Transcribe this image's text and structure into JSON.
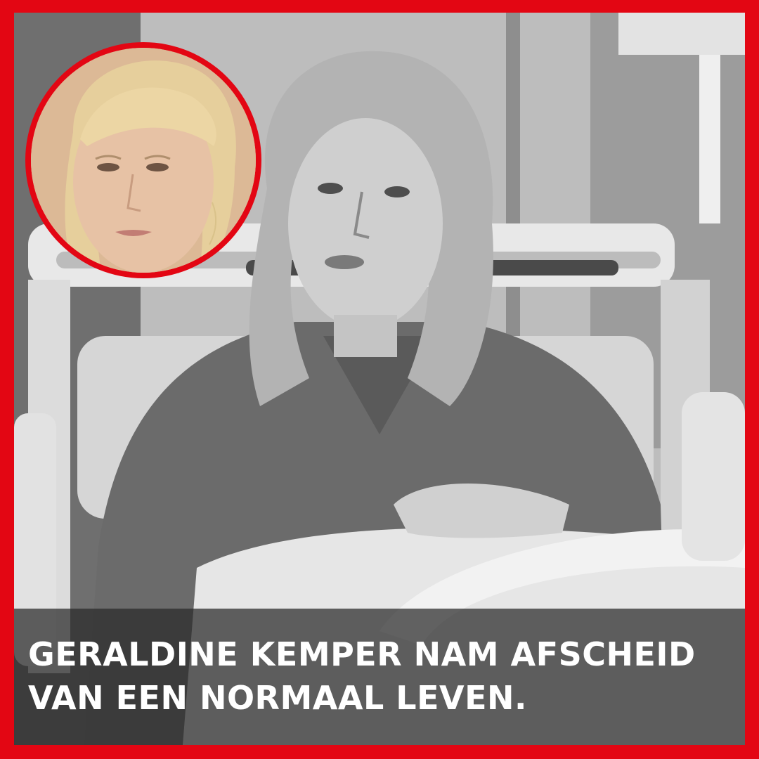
{
  "caption": {
    "text": "GERALDINE KEMPER NAM AFSCHEID VAN EEN NORMAAL LEVEN."
  },
  "colors": {
    "border": "#e30613",
    "caption_text": "#ffffff"
  }
}
